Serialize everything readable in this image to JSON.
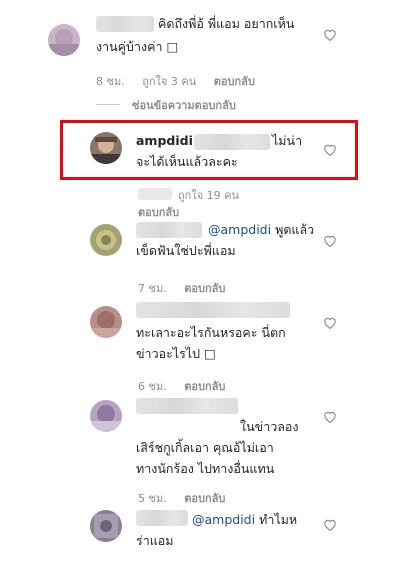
{
  "comments": [
    {
      "text": "คิดถึงพี่อ้ พี่แอม อยากเห็น",
      "text2": "งานคู่บ้างค่า □",
      "time": "8 ชม.",
      "likes": "ถูกใจ 3 คน",
      "reply": "ตอบกลับ",
      "hide_replies": "ซ่อนข้อความตอบกลับ"
    },
    {
      "username": "ampdidi",
      "text": "ไม่น่า",
      "text2": "จะได้เห็นแล้วละคะ",
      "likes": "ถูกใจ 19 คน",
      "reply": "ตอบกลับ"
    },
    {
      "mention": "@ampdidi",
      "text": "พูดแล้ว",
      "text2": "เข็ดฟันใช่ปะพี่แอม",
      "time": "7 ชม.",
      "reply": "ตอบกลับ"
    },
    {
      "text": "ทะเลาะอะไรกันหรอคะ นี่ตก",
      "text2": "ข่าวอะไรไป □",
      "time": "6 ชม.",
      "reply": "ตอบกลับ"
    },
    {
      "text": "ในข่าวลอง",
      "text2": "เสิร์ชกูเกิ้ลเอา คุณอ้ไม่เอา",
      "text3": "ทางนักร้อง ไปทางอื่นแทน",
      "time": "5 ชม.",
      "reply": "ตอบกลับ"
    },
    {
      "mention": "@ampdidi",
      "text": "ทำไมห",
      "text2": "ร่าแอม"
    }
  ]
}
